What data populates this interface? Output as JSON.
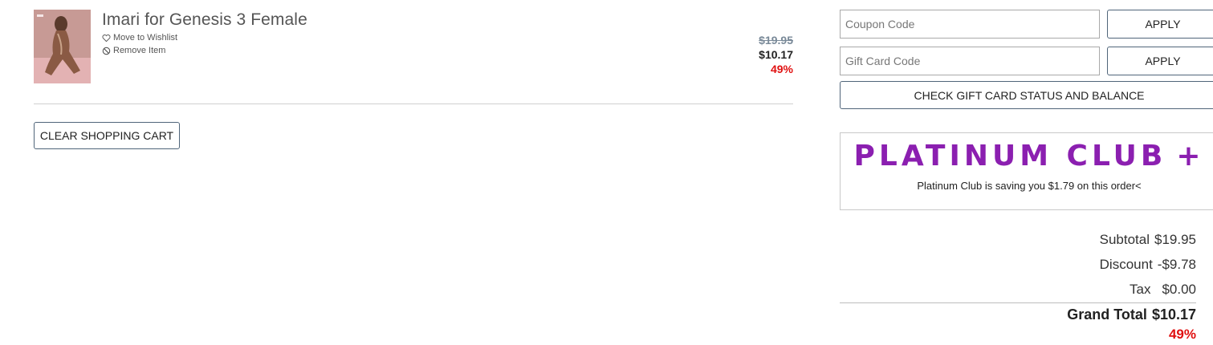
{
  "item": {
    "title": "Imari for Genesis 3 Female",
    "wishlist_label": "Move to Wishlist",
    "remove_label": "Remove Item",
    "price_original": "$19.95",
    "price_sale": "$10.17",
    "discount_percent": "49%"
  },
  "cart_actions": {
    "clear_label": "CLEAR SHOPPING CART"
  },
  "promo": {
    "coupon_placeholder": "Coupon Code",
    "gift_placeholder": "Gift Card Code",
    "apply_label": "APPLY",
    "gift_apply_label": "APPLY",
    "check_gift_label": "CHECK GIFT CARD STATUS AND BALANCE"
  },
  "platinum": {
    "logo_text": "PLATINUM CLUB",
    "logo_plus": "+",
    "savings_text": "Platinum Club is saving you $1.79 on this order<",
    "logo_color": "#8b1fb0"
  },
  "totals": {
    "subtotal_label": "Subtotal",
    "subtotal_value": "$19.95",
    "discount_label": "Discount",
    "discount_value": "-$9.78",
    "tax_label": "Tax",
    "tax_value": "$0.00",
    "grand_label": "Grand Total",
    "grand_value": "$10.17",
    "grand_percent": "49%"
  },
  "colors": {
    "accent_red": "#e01010",
    "border": "#50657a"
  }
}
